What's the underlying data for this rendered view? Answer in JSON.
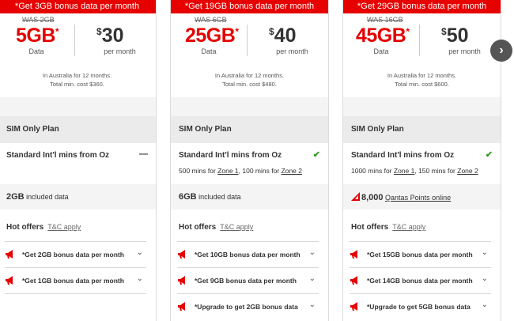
{
  "cards": [
    {
      "banner": "*Get 3GB bonus data per month",
      "was": "WAS 2GB",
      "data_amount": "5GB",
      "data_asterisk": "*",
      "data_label": "Data",
      "price_currency": "$",
      "price": "30",
      "price_period": "per month",
      "note_line1": "In Australia for 12 months.",
      "note_line2": "Total min. cost $360.",
      "plan_label": "SIM Only Plan",
      "mins_title": "Standard Int'l mins from Oz",
      "mins_icon": "minus-icon",
      "included_amount": "2GB",
      "included_text": "included data",
      "hot_offers": "Hot offers",
      "tc": "T&C apply",
      "offers": [
        "*Get 2GB bonus data per month",
        "*Get 1GB bonus data per month"
      ]
    },
    {
      "banner": "*Get 19GB bonus data per month",
      "was": "WAS 6GB",
      "data_amount": "25GB",
      "data_asterisk": "*",
      "data_label": "Data",
      "price_currency": "$",
      "price": "40",
      "price_period": "per month",
      "note_line1": "In Australia for 12 months.",
      "note_line2": "Total min. cost $480.",
      "plan_label": "SIM Only Plan",
      "mins_title": "Standard Int'l mins from Oz",
      "mins_icon": "check-icon",
      "mins_detail": {
        "mins1": "500 mins",
        "for": "for",
        "zone1": "Zone 1",
        "mins2": ", 100 mins",
        "for2": "for",
        "zone2": "Zone 2"
      },
      "included_amount": "6GB",
      "included_text": "included data",
      "hot_offers": "Hot offers",
      "tc": "T&C apply",
      "offers": [
        "*Get 10GB bonus data per month",
        "*Get 9GB bonus data per month",
        "*Upgrade to get 2GB bonus data"
      ]
    },
    {
      "banner": "*Get 29GB bonus data per month",
      "was": "WAS 16GB",
      "data_amount": "45GB",
      "data_asterisk": "*",
      "data_label": "Data",
      "price_currency": "$",
      "price": "50",
      "price_period": "per month",
      "note_line1": "In Australia for 12 months.",
      "note_line2": "Total min. cost $600.",
      "plan_label": "SIM Only Plan",
      "mins_title": "Standard Int'l mins from Oz",
      "mins_icon": "check-icon",
      "mins_detail": {
        "mins1": "1000 mins",
        "for": "for",
        "zone1": "Zone 1",
        "mins2": ", 150 mins",
        "for2": "for",
        "zone2": "Zone 2"
      },
      "qantas_points": "8,000",
      "qantas_text": "Qantas Points online",
      "hot_offers": "Hot offers",
      "tc": "T&C apply",
      "offers": [
        "*Get 15GB bonus data per month",
        "*Get 14GB bonus data per month",
        "*Upgrade to get 5GB bonus data"
      ]
    }
  ],
  "nav": {
    "next_icon": "chevron-right-icon",
    "next_glyph": "›"
  },
  "glyphs": {
    "minus": "—",
    "check": "✔",
    "chevron": "⌄"
  },
  "colors": {
    "brand_red": "#e60000",
    "check_green": "#3a9c2e"
  }
}
